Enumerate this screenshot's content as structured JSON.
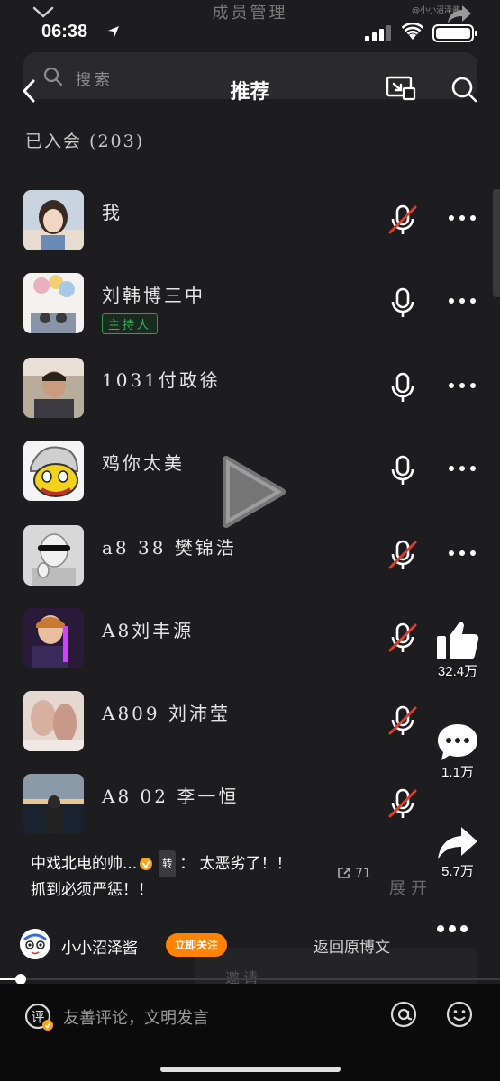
{
  "status_bar": {
    "time": "06:38"
  },
  "video_overlay": {
    "title": "成员管理",
    "watermark": "@小小沼泽酱"
  },
  "nav": {
    "search_placeholder": "搜索",
    "title": "推荐"
  },
  "members_header": "已入会 (203)",
  "members": [
    {
      "name": "我",
      "mic": "muted",
      "badge": ""
    },
    {
      "name": "刘韩博三中",
      "mic": "on",
      "badge": "主持人"
    },
    {
      "name": "1031付政徐",
      "mic": "on",
      "badge": ""
    },
    {
      "name": "鸡你太美",
      "mic": "on",
      "badge": ""
    },
    {
      "name": "a8 38 樊锦浩",
      "mic": "muted",
      "badge": ""
    },
    {
      "name": "A8刘丰源",
      "mic": "muted",
      "badge": ""
    },
    {
      "name": "A809 刘沛莹",
      "mic": "muted",
      "badge": ""
    },
    {
      "name": "A8 02 李一恒",
      "mic": "muted",
      "badge": ""
    }
  ],
  "side_actions": {
    "likes": "32.4万",
    "comments": "1.1万",
    "shares": "5.7万"
  },
  "caption": {
    "author": "中戏北电的帅...",
    "repost_tag": "转",
    "text_line1": "：  太恶劣了！！",
    "text_line2": "抓到必须严惩！！",
    "forward_count": "71",
    "bg_text": "展开"
  },
  "author_row": {
    "name": "小小沼泽酱",
    "follow_label": "立即关注",
    "return_label": "返回原博文",
    "invite_text": "邀请"
  },
  "progress": {
    "value": 0.04
  },
  "comment_bar": {
    "placeholder": "友善评论，文明发言"
  },
  "colors": {
    "background": "#1d1d1f",
    "accent_follow": "#ff8200",
    "muted_red": "#e23b2e",
    "host_green": "#37b659"
  }
}
